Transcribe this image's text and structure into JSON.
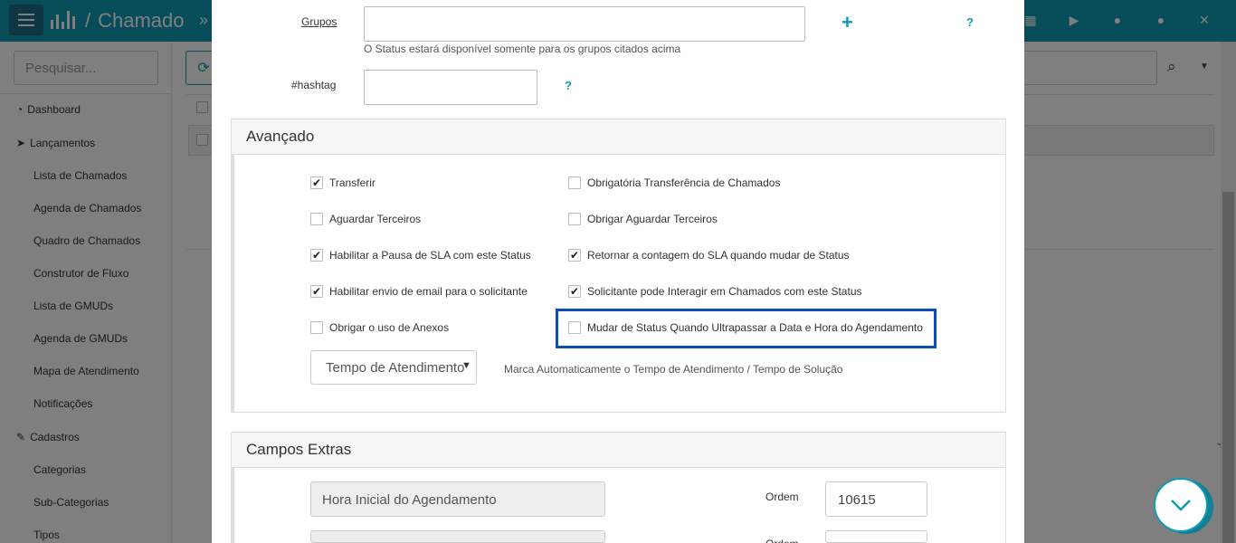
{
  "header": {
    "title": "Chamado",
    "separator": "/",
    "arrow": "»",
    "icons": [
      "grid-icon",
      "play-icon",
      "help-icon",
      "user-icon",
      "expand-icon"
    ]
  },
  "sidebar": {
    "search_placeholder": "Pesquisar...",
    "items": {
      "dashboard": "Dashboard",
      "lancamentos": "Lançamentos",
      "lista_chamados": "Lista de Chamados",
      "agenda_chamados": "Agenda de Chamados",
      "quadro_chamados": "Quadro de Chamados",
      "construtor_fluxo": "Construtor de Fluxo",
      "lista_gmuds": "Lista de GMUDs",
      "agenda_gmuds": "Agenda de GMUDs",
      "mapa_atendimento": "Mapa de Atendimento",
      "notificacoes": "Notificações",
      "cadastros": "Cadastros",
      "categorias": "Categorias",
      "sub_categorias": "Sub-Categorias",
      "tipos": "Tipos"
    }
  },
  "modal": {
    "grupos_label": "Grupos",
    "grupos_note": "O Status estará disponível somente para os grupos citados acima",
    "hashtag_label": "#hashtag",
    "help_symbol": "?",
    "plus_symbol": "+",
    "advanced": {
      "title": "Avançado",
      "checkboxes": [
        {
          "label": "Transferir",
          "checked": true
        },
        {
          "label": "Obrigatória Transferência de Chamados",
          "checked": false
        },
        {
          "label": "Aguardar Terceiros",
          "checked": false
        },
        {
          "label": "Obrigar Aguardar Terceiros",
          "checked": false
        },
        {
          "label": "Habilitar a Pausa de SLA com este Status",
          "checked": true
        },
        {
          "label": "Retornar a contagem do SLA quando mudar de Status",
          "checked": true
        },
        {
          "label": "Habilitar envio de email para o solicitante",
          "checked": true
        },
        {
          "label": "Solicitante pode Interagir em Chamados com este Status",
          "checked": true
        },
        {
          "label": "Obrigar o uso de Anexos",
          "checked": false
        },
        {
          "label": "Mudar de Status Quando Ultrapassar a Data e Hora do Agendamento",
          "checked": false
        }
      ],
      "select_value": "Tempo de Atendimento",
      "select_note": "Marca Automaticamente o Tempo de Atendimento / Tempo de Solução"
    },
    "extras": {
      "title": "Campos Extras",
      "field1_value": "Hora Inicial do Agendamento",
      "ordem_label": "Ordem",
      "ordem_value": "10615",
      "ordem2_label": "Ordem"
    }
  },
  "colors": {
    "accent": "#0e9bb3",
    "highlight": "#0a4fb7"
  }
}
